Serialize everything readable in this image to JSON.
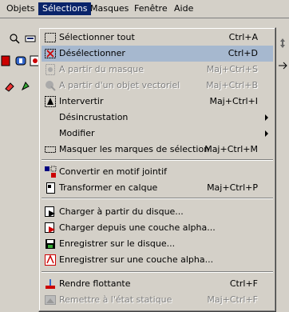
{
  "menubar": {
    "items": [
      {
        "label": "Objets"
      },
      {
        "label": "Sélections"
      },
      {
        "label": "Masques"
      },
      {
        "label": "Fenêtre"
      },
      {
        "label": "Aide"
      }
    ]
  },
  "menu": {
    "items": [
      {
        "label": "Sélectionner tout",
        "shortcut": "Ctrl+A",
        "enabled": true
      },
      {
        "label": "Désélectionner",
        "shortcut": "Ctrl+D",
        "enabled": true,
        "highlighted": true
      },
      {
        "label": "A partir du masque",
        "shortcut": "Maj+Ctrl+S",
        "enabled": false
      },
      {
        "label": "A partir d'un objet vectoriel",
        "shortcut": "Maj+Ctrl+B",
        "enabled": false
      },
      {
        "label": "Intervertir",
        "shortcut": "Maj+Ctrl+I",
        "enabled": true
      },
      {
        "label": "Désincrustation",
        "shortcut": "",
        "enabled": true,
        "submenu": true
      },
      {
        "label": "Modifier",
        "shortcut": "",
        "enabled": true,
        "submenu": true
      },
      {
        "label": "Masquer les marques de sélection",
        "shortcut": "Maj+Ctrl+M",
        "enabled": true
      },
      {
        "label": "Convertir en motif jointif",
        "shortcut": "",
        "enabled": true
      },
      {
        "label": "Transformer en calque",
        "shortcut": "Maj+Ctrl+P",
        "enabled": true
      },
      {
        "label": "Charger à partir du disque...",
        "shortcut": "",
        "enabled": true
      },
      {
        "label": "Charger depuis une couche alpha...",
        "shortcut": "",
        "enabled": true
      },
      {
        "label": "Enregistrer sur le disque...",
        "shortcut": "",
        "enabled": true
      },
      {
        "label": "Enregistrer sur une couche alpha...",
        "shortcut": "",
        "enabled": true
      },
      {
        "label": "Rendre flottante",
        "shortcut": "Ctrl+F",
        "enabled": true
      },
      {
        "label": "Remettre à l'état statique",
        "shortcut": "Maj+Ctrl+F",
        "enabled": false
      }
    ]
  },
  "colors": {
    "menubar_active": "#0a246a",
    "highlight": "#a6b8cf",
    "face": "#d4d0c8",
    "disabled_text": "#808080"
  }
}
